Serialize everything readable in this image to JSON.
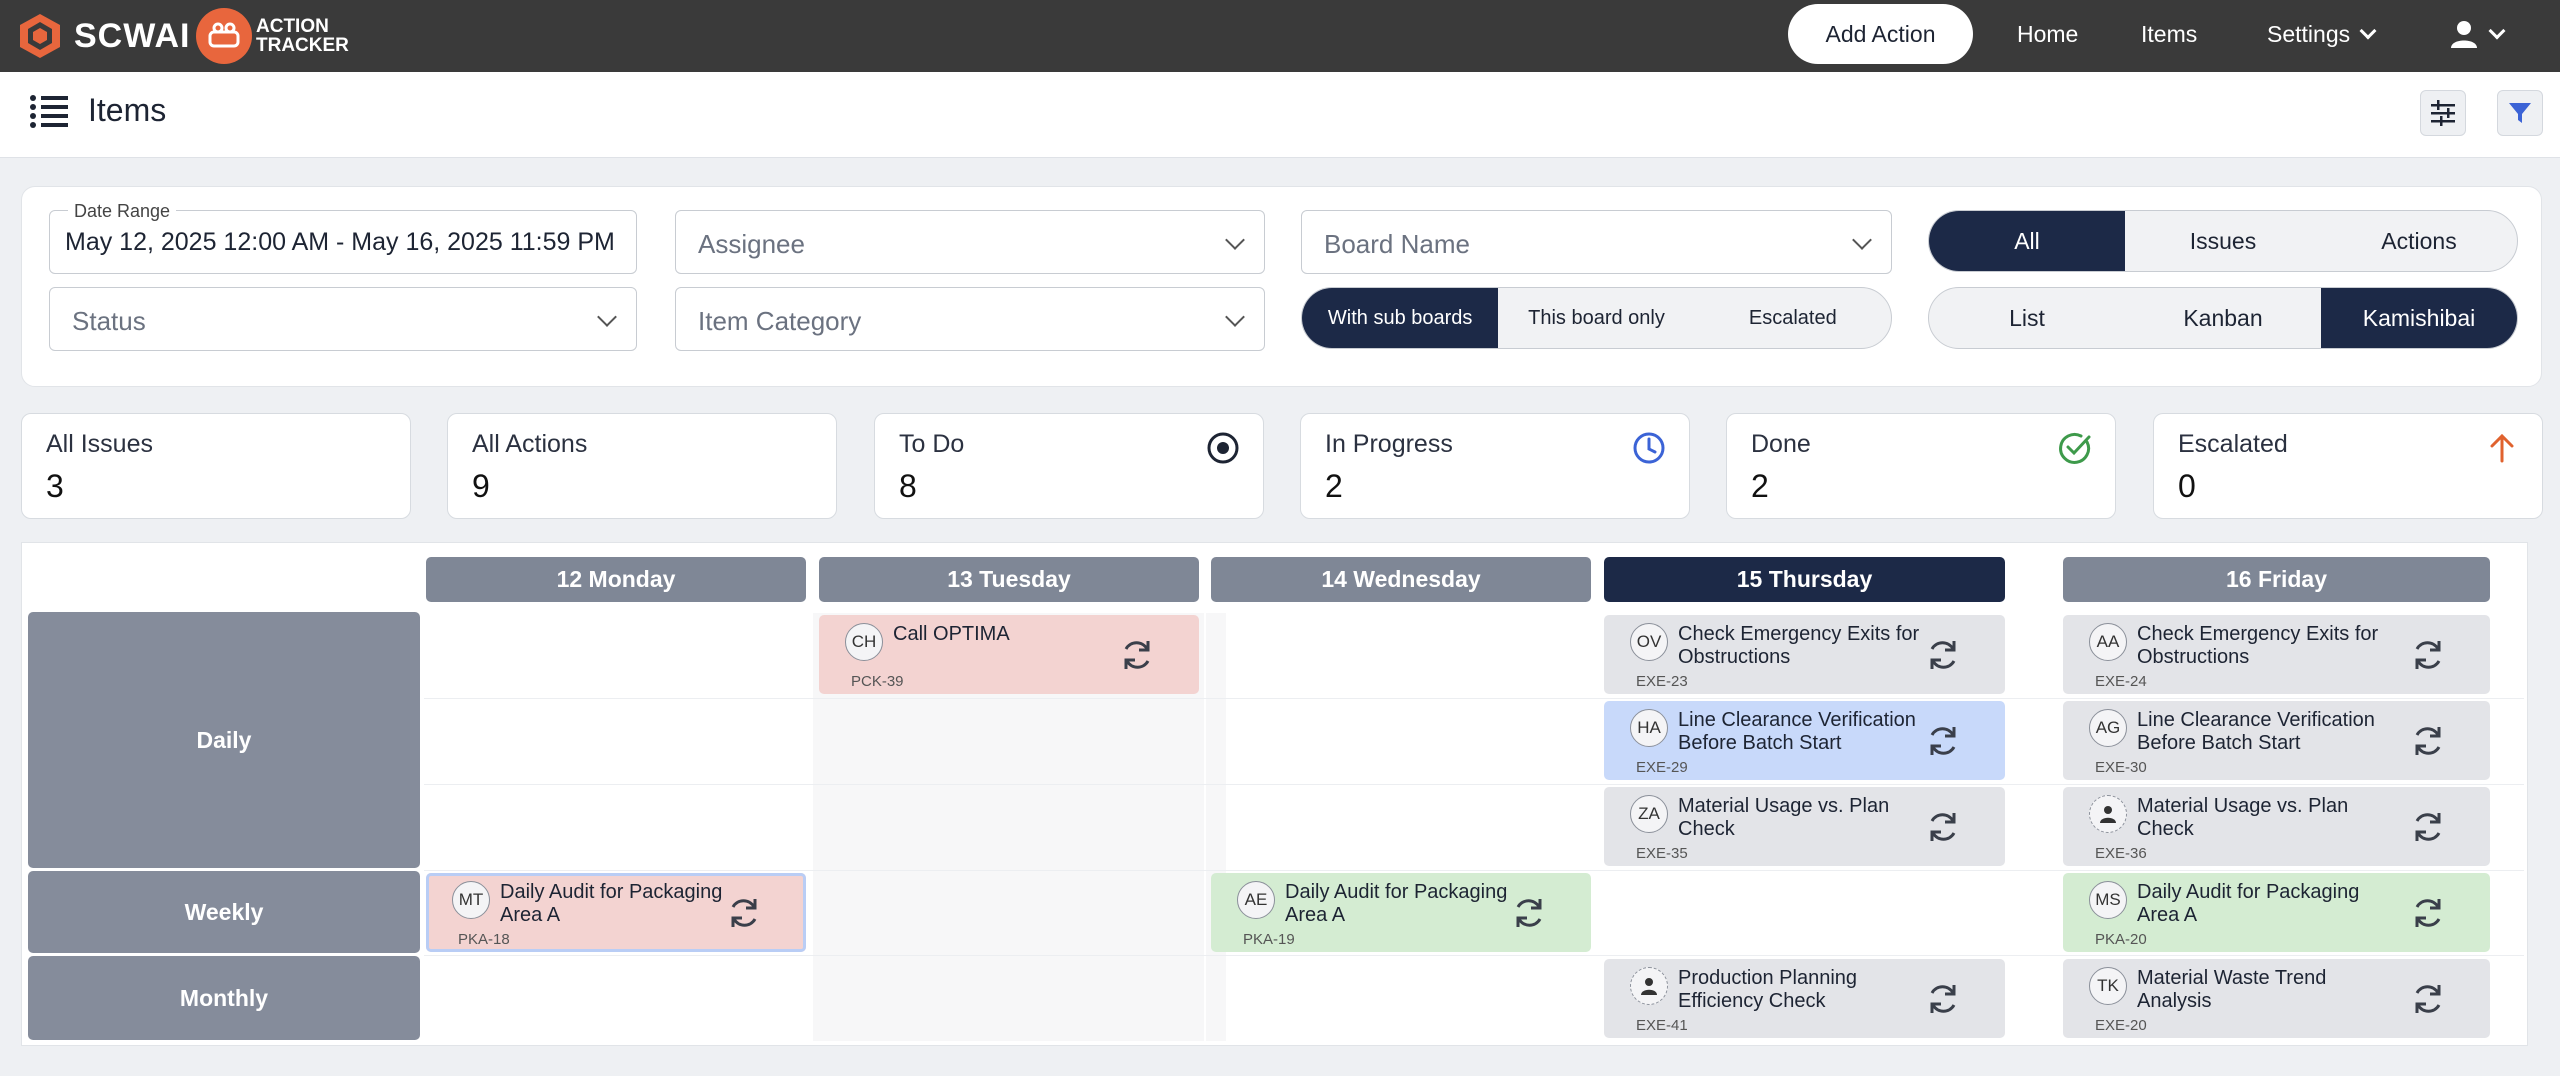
{
  "app": {
    "brand": "SCW",
    "brand_suffix": "AI",
    "product_line1": "ACTION",
    "product_line2": "TRACKER"
  },
  "nav": {
    "add_action": "Add Action",
    "home": "Home",
    "items": "Items",
    "settings": "Settings"
  },
  "page": {
    "title": "Items"
  },
  "filters": {
    "date_range_label": "Date Range",
    "date_range_value": "May 12, 2025 12:00 AM - May 16, 2025 11:59 PM",
    "status_placeholder": "Status",
    "assignee_placeholder": "Assignee",
    "item_category_placeholder": "Item Category",
    "board_name_placeholder": "Board Name",
    "board_scope": [
      "With sub boards",
      "This board only",
      "Escalated"
    ],
    "board_scope_selected": "With sub boards",
    "item_type": [
      "All",
      "Issues",
      "Actions"
    ],
    "item_type_selected": "All",
    "view_mode": [
      "List",
      "Kanban",
      "Kamishibai"
    ],
    "view_mode_selected": "Kamishibai"
  },
  "stats": [
    {
      "label": "All Issues",
      "value": "3",
      "icon": ""
    },
    {
      "label": "All Actions",
      "value": "9",
      "icon": ""
    },
    {
      "label": "To Do",
      "value": "8",
      "icon": "target-icon",
      "color": "#1d2433"
    },
    {
      "label": "In Progress",
      "value": "2",
      "icon": "clock-icon",
      "color": "#3b63d6"
    },
    {
      "label": "Done",
      "value": "2",
      "icon": "check-circle-icon",
      "color": "#3e9a4b"
    },
    {
      "label": "Escalated",
      "value": "0",
      "icon": "arrow-up-icon",
      "color": "#e0622e"
    }
  ],
  "calendar": {
    "days": [
      "12 Monday",
      "13 Tuesday",
      "14 Wednesday",
      "15 Thursday",
      "16 Friday"
    ],
    "today": "15 Thursday",
    "rows": [
      "Daily",
      "Weekly",
      "Monthly"
    ],
    "cards": [
      {
        "initials": "CH",
        "title": "Call OPTIMA",
        "id": "PCK-39",
        "color": "red"
      },
      {
        "initials": "OV",
        "title": "Check Emergency Exits for Obstructions",
        "id": "EXE-23",
        "color": "grey"
      },
      {
        "initials": "HA",
        "title": "Line Clearance Verification Before Batch Start",
        "id": "EXE-29",
        "color": "blue"
      },
      {
        "initials": "ZA",
        "title": "Material Usage vs. Plan Check",
        "id": "EXE-35",
        "color": "grey"
      },
      {
        "initials": "AA",
        "title": "Check Emergency Exits for Obstructions",
        "id": "EXE-24",
        "color": "grey"
      },
      {
        "initials": "AG",
        "title": "Line Clearance Verification Before Batch Start",
        "id": "EXE-30",
        "color": "grey"
      },
      {
        "initials": "",
        "title": "Material Usage vs. Plan Check",
        "id": "EXE-36",
        "color": "grey",
        "avatar_icon": "person-icon"
      },
      {
        "initials": "MT",
        "title": "Daily Audit for Packaging Area A",
        "id": "PKA-18",
        "color": "red"
      },
      {
        "initials": "AE",
        "title": "Daily Audit for Packaging Area A",
        "id": "PKA-19",
        "color": "green"
      },
      {
        "initials": "MS",
        "title": "Daily Audit for Packaging Area A",
        "id": "PKA-20",
        "color": "green"
      },
      {
        "initials": "",
        "title": "Production Planning Efficiency Check",
        "id": "EXE-41",
        "color": "grey",
        "avatar_icon": "person-icon"
      },
      {
        "initials": "TK",
        "title": "Material Waste Trend Analysis",
        "id": "EXE-20",
        "color": "grey"
      }
    ]
  },
  "colors": {
    "topbar": "#3a3a3a",
    "navy": "#1c2947",
    "brand_orange": "#e8663d"
  }
}
